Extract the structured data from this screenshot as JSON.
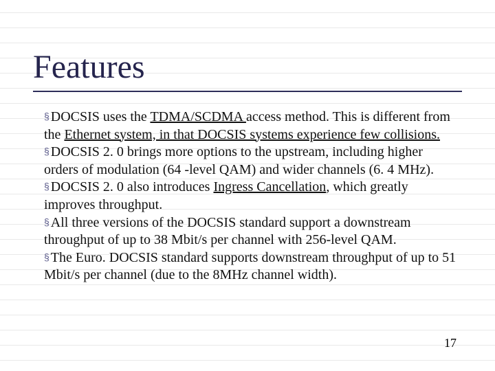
{
  "slide": {
    "title": "Features",
    "page_number": "17",
    "bullets": [
      {
        "pre": "DOCSIS uses the ",
        "u1": "TDMA/SCDMA ",
        "mid1": "access method. This is different from the ",
        "u2": "Ethernet system, in that DOCSIS systems experience few collisions.",
        "post": ""
      },
      {
        "pre": "DOCSIS 2. 0 brings more options to the upstream, including higher orders of modulation (64 -level QAM) and wider channels (6. 4 MHz).",
        "u1": "",
        "mid1": "",
        "u2": "",
        "post": ""
      },
      {
        "pre": "DOCSIS 2. 0 also introduces ",
        "u1": "Ingress Cancellation",
        "mid1": ", which greatly improves throughput.",
        "u2": "",
        "post": ""
      },
      {
        "pre": "All three versions of the DOCSIS standard support a downstream throughput of up to 38 Mbit/s per channel with 256-level QAM.",
        "u1": "",
        "mid1": "",
        "u2": "",
        "post": ""
      },
      {
        "pre": "The Euro. DOCSIS standard supports downstream throughput of up to 51 Mbit/s per channel (due to the 8MHz channel width).",
        "u1": "",
        "mid1": "",
        "u2": "",
        "post": ""
      }
    ],
    "bullet_glyph": "§"
  }
}
